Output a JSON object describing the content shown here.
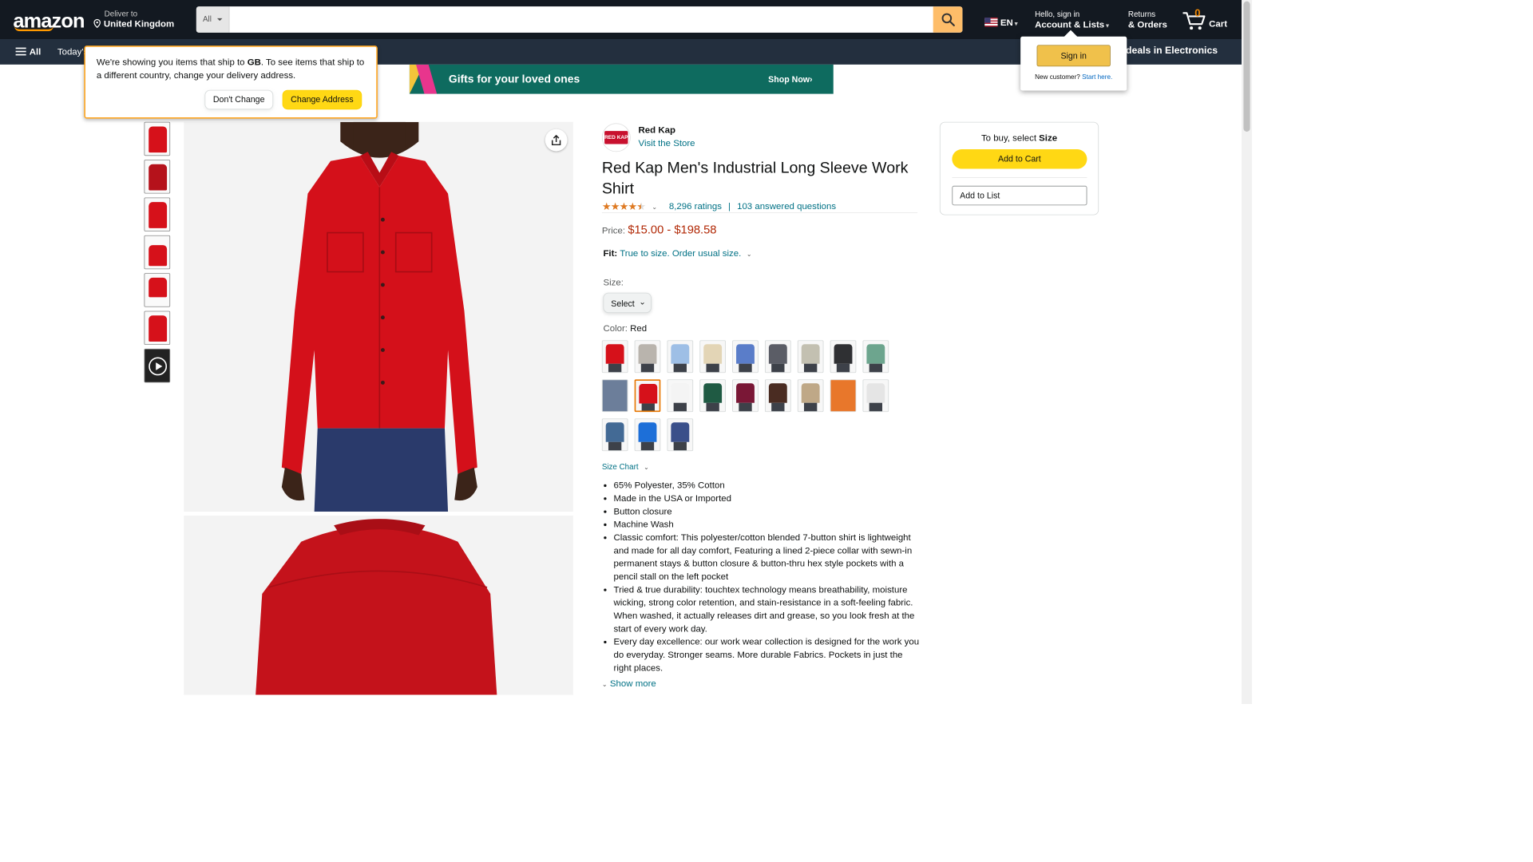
{
  "header": {
    "logo": "amazon",
    "deliver_line1": "Deliver to",
    "deliver_line2": "United Kingdom",
    "search_category": "All",
    "search_placeholder": "",
    "language": "EN",
    "account_line1": "Hello, sign in",
    "account_line2": "Account & Lists",
    "returns_line1": "Returns",
    "returns_line2": "& Orders",
    "cart_count": "0",
    "cart_label": "Cart"
  },
  "subnav": {
    "all_label": "All",
    "today_label": "Today's",
    "deals_label": "op deals in Electronics"
  },
  "ship_popover": {
    "text_prefix": "We're showing you items that ship to ",
    "country": "GB",
    "text_suffix": ". To see items that ship to a different country, change your delivery address.",
    "dont_change": "Don't Change",
    "change_address": "Change Address"
  },
  "signin_flyout": {
    "button": "Sign in",
    "new_customer": "New customer?",
    "start_here": "Start here."
  },
  "banner": {
    "text": "Gifts for your loved ones",
    "cta": "Shop Now›"
  },
  "product": {
    "brand_logo_text": "RED KAP",
    "brand": "Red Kap",
    "visit_store": "Visit the Store",
    "title": "Red Kap Men's Industrial Long Sleeve Work Shirt",
    "rating_value": 4.5,
    "ratings_count": "8,296 ratings",
    "separator": "|",
    "answered": "103 answered questions",
    "price_label": "Price:",
    "price_range": "$15.00 - $198.58",
    "fit_label": "Fit:",
    "fit_text": "True to size. Order usual size.",
    "size_label": "Size:",
    "size_select": "Select",
    "color_label": "Color:",
    "color_value": "Red",
    "size_chart": "Size Chart",
    "bullets": [
      "65% Polyester, 35% Cotton",
      "Made in the USA or Imported",
      "Button closure",
      "Machine Wash",
      "Classic comfort: This polyester/cotton blended 7-button shirt is lightweight and made for all day comfort, Featuring a lined 2-piece collar with sewn-in permanent stays & button closure & button-thru hex style pockets with a pencil stall on the left pocket",
      "Tried & true durability: touchtex technology means breathability, moisture wicking, strong color retention, and stain-resistance in a soft-feeling fabric. When washed, it actually releases dirt and grease, so you look fresh at the start of every work day.",
      "Every day excellence: our work wear collection is designed for the work you do everyday. Stronger seams. More durable Fabrics. Pockets in just the right places."
    ],
    "show_more": "Show more"
  },
  "swatches": [
    {
      "color": "#d6111a",
      "solid": false,
      "selected": false
    },
    {
      "color": "#b9b4ad",
      "solid": false,
      "selected": false
    },
    {
      "color": "#9ebfe6",
      "solid": false,
      "selected": false
    },
    {
      "color": "#e3d5b6",
      "solid": false,
      "selected": false
    },
    {
      "color": "#5a7dc9",
      "solid": false,
      "selected": false
    },
    {
      "color": "#5b5d66",
      "solid": false,
      "selected": false
    },
    {
      "color": "#c3c0b1",
      "solid": false,
      "selected": false
    },
    {
      "color": "#2f3033",
      "solid": false,
      "selected": false
    },
    {
      "color": "#6da58e",
      "solid": false,
      "selected": false
    },
    {
      "color": "#6c7e9a",
      "solid": true,
      "selected": false
    },
    {
      "color": "#d6111a",
      "solid": false,
      "selected": true
    },
    {
      "color": "#f4f4f4",
      "solid": false,
      "selected": false
    },
    {
      "color": "#1f5a43",
      "solid": false,
      "selected": false
    },
    {
      "color": "#7a1736",
      "solid": false,
      "selected": false
    },
    {
      "color": "#4a2c22",
      "solid": false,
      "selected": false
    },
    {
      "color": "#bfa887",
      "solid": false,
      "selected": false
    },
    {
      "color": "#e8772b",
      "solid": true,
      "selected": false
    },
    {
      "color": "#e5e5e5",
      "solid": false,
      "selected": false
    },
    {
      "color": "#436a95",
      "solid": false,
      "selected": false
    },
    {
      "color": "#1d6fd8",
      "solid": false,
      "selected": false
    },
    {
      "color": "#3a4f8a",
      "solid": false,
      "selected": false
    }
  ],
  "buybox": {
    "to_buy": "To buy, select ",
    "to_buy_bold": "Size",
    "add_to_cart": "Add to Cart",
    "add_to_list": "Add to List"
  },
  "colors": {
    "nav_bg": "#131921",
    "subnav_bg": "#232f3e",
    "accent": "#febd69",
    "price": "#b12704",
    "link": "#007185"
  }
}
